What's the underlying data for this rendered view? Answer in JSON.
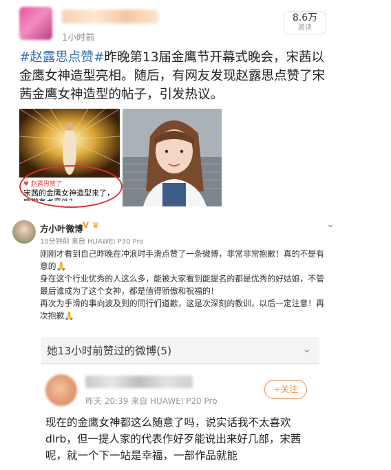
{
  "post": {
    "time": "1小时前",
    "read_count": "8.6万",
    "read_label": "阅读",
    "hashtag": "#赵露思点赞#",
    "text": "昨晚第13届金鹰节开幕式晚会，宋茜以金鹰女神造型亮相。随后，有网友发现赵露思点赞了宋茜金鹰女神造型的帖子，引发热议。",
    "image1_caption_sub": "赵露思赞了",
    "image1_caption_main": "宋茜的金鹰女神造型来了，",
    "image1_caption_cut": "感觉有点意外？"
  },
  "apology": {
    "username": "方小叶微博",
    "verified_badge": "V",
    "meta": "10分钟前 来自 HUAWEI P30 Pro",
    "paragraphs": [
      "刚刚才看到自己昨晚在冲浪时手滑点赞了一条微博，非常非常抱歉！真的不是有意的",
      "身在这个行业优秀的人这么多，能被大家看到能提名的都是优秀的好姑娘，不管最后谁成为了这个女神，都是值得骄傲和祝福的！",
      "再次为手滑的事向波及到的同行们道歉，这是次深刻的教训，以后一定注意！再次抱歉"
    ]
  },
  "likes": {
    "title": "她13小时前赞过的微博(5)",
    "meta": "昨天 20:39  来自 HUAWEI P20 Pro",
    "follow_label": "+关注",
    "text": "现在的金鹰女神都这么随意了吗，说实话我不太喜欢dlrb，但一提人家的代表作好歹能说出来好几部，宋茜呢，就一个下一站是幸福，一部作品就能"
  },
  "icons": {
    "apology_chevron": "chevron-down-icon",
    "likes_chevron": "chevron-down-icon"
  },
  "colors": {
    "hashtag": "#3a6fb9",
    "follow": "#f0883a",
    "circle": "#e03030"
  }
}
